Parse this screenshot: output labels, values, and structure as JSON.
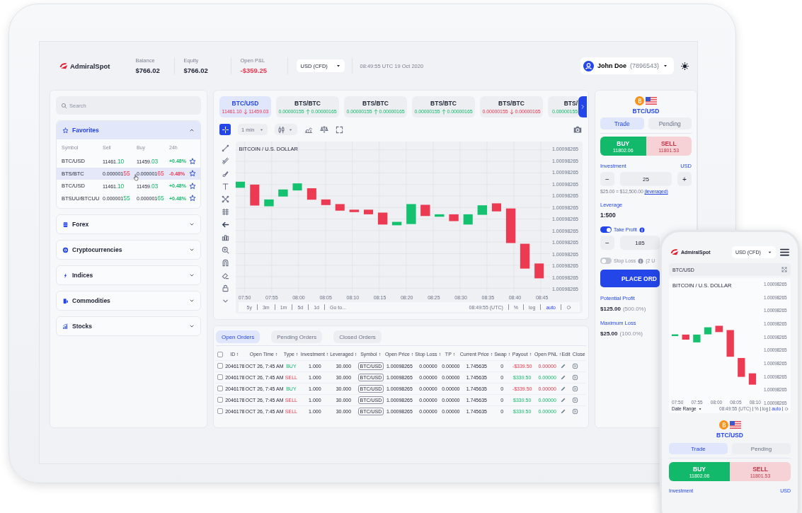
{
  "header": {
    "logo": "AdmiralSpot",
    "stats": [
      {
        "label": "Balance",
        "value": "$766.02",
        "negative": false
      },
      {
        "label": "Equity",
        "value": "$766.02",
        "negative": false
      },
      {
        "label": "Open P&L",
        "value": "-$359.25",
        "negative": true
      }
    ],
    "currency": "USD (CFD)",
    "time": "08:49:55 UTC 19 Oct 2020",
    "user": {
      "name": "John Doe",
      "account": "(7896543)"
    }
  },
  "sidebar": {
    "search": {
      "placeholder": "Search"
    },
    "favorites": {
      "title": "Favorites",
      "expanded": true,
      "columns": [
        "Symbol",
        "Sell",
        "Buy",
        "24h"
      ],
      "rows": [
        {
          "symbol": "BTC/USD",
          "sell": "11461.**10**",
          "sell_positive": true,
          "buy": "11459.**03**",
          "buy_positive": true,
          "change": "+0.48%",
          "change_positive": true,
          "selected": false
        },
        {
          "symbol": "BTS/BTC",
          "sell": "0.000001**55**",
          "sell_positive": false,
          "buy": "0.000001**65**",
          "buy_positive": false,
          "change": "-0.48%",
          "change_positive": false,
          "selected": true
        },
        {
          "symbol": "BTC/USD",
          "sell": "11461.**10**",
          "sell_positive": true,
          "buy": "11459.**03**",
          "buy_positive": true,
          "change": "+0.48%",
          "change_positive": true,
          "selected": false
        },
        {
          "symbol": "BTSUU/BTCUU",
          "sell": "0.000001**55**",
          "sell_positive": true,
          "buy": "0.000001**65**",
          "buy_positive": true,
          "change": "+0.48%",
          "change_positive": true,
          "selected": false
        }
      ]
    },
    "categories": [
      {
        "label": "Forex",
        "expanded": false
      },
      {
        "label": "Cryptocurrencies",
        "expanded": false
      },
      {
        "label": "Indices",
        "expanded": false
      },
      {
        "label": "Commodities",
        "expanded": false
      },
      {
        "label": "Stocks",
        "expanded": false
      }
    ]
  },
  "chart": {
    "tickers": [
      {
        "symbol": "BTC/USD",
        "sell": "11461.10",
        "buy": "11459.03",
        "rising": false,
        "selected": true
      },
      {
        "symbol": "BTS/BTC",
        "sell": "0.00000155",
        "buy": "0.00000165",
        "rising": true,
        "selected": false
      },
      {
        "symbol": "BTS/BTC",
        "sell": "0.00000155",
        "buy": "0.00000165",
        "rising": true,
        "selected": false
      },
      {
        "symbol": "BTS/BTC",
        "sell": "0.00000155",
        "buy": "0.00000165",
        "rising": true,
        "selected": false
      },
      {
        "symbol": "BTS/BTC",
        "sell": "0.00000155",
        "buy": "0.00000165",
        "rising": false,
        "selected": false
      },
      {
        "symbol": "BTS/",
        "sell": "0.00000155",
        "rising": true,
        "selected": false
      }
    ],
    "interval": "1 min",
    "title": "BITCOIN / U.S. DOLLAR",
    "y_labels": [
      "1.00098265",
      "1.00098265",
      "1.00098265",
      "1.00098265",
      "1.00098265",
      "1.00098265",
      "1.00098265",
      "1.00098265",
      "1.00098265",
      "1.00098265",
      "1.00098265",
      "1.00098265",
      "1.00098265"
    ],
    "x_labels": [
      "07:50",
      "07:55",
      "08:00",
      "08:05",
      "08:10",
      "08:15",
      "08:20",
      "08:25",
      "08:30",
      "08:35",
      "08:40",
      "08:45"
    ],
    "ranges": [
      "5y",
      "3m",
      "1m",
      "5d",
      "1d",
      "Go to..."
    ],
    "clock": "08:49:55 (UTC)",
    "scale_options": [
      {
        "label": "%",
        "selected": false
      },
      {
        "label": "log",
        "selected": false
      },
      {
        "label": "auto",
        "selected": true
      }
    ]
  },
  "orders": {
    "tabs": [
      {
        "label": "Open Orders",
        "selected": true
      },
      {
        "label": "Pending Orders",
        "selected": false
      },
      {
        "label": "Closed Orders",
        "selected": false
      }
    ],
    "select_all": {
      "checked": false
    },
    "columns": [
      {
        "label": "ID",
        "sortable": true
      },
      {
        "label": "Open Time",
        "sortable": true
      },
      {
        "label": "Type",
        "sortable": true
      },
      {
        "label": "Investment",
        "sortable": true
      },
      {
        "label": "Leveraged",
        "sortable": true
      },
      {
        "label": "Symbol",
        "sortable": true
      },
      {
        "label": "Open Price",
        "sortable": true
      },
      {
        "label": "Stop Loss",
        "sortable": true
      },
      {
        "label": "TP",
        "sortable": true
      },
      {
        "label": "Current Price",
        "sortable": true
      },
      {
        "label": "Swap",
        "sortable": true
      },
      {
        "label": "Payout",
        "sortable": true
      },
      {
        "label": "Open PNL",
        "sortable": true
      },
      {
        "label": "Edit",
        "sortable": false
      },
      {
        "label": "Close",
        "sortable": false
      }
    ],
    "rows": [
      {
        "checked": false,
        "id": "2046178",
        "open_time": "OCT 26, 7:45 AM",
        "type": "BUY",
        "type_positive": true,
        "investment": "1.000",
        "leveraged": "30.000",
        "symbol": "BTC/USD",
        "open_price": "1.00098265",
        "stop_loss": "0.00000",
        "tp": "0.00000",
        "current_price": "1.745635",
        "swap": "0",
        "payout": "-$339.50",
        "payout_positive": false,
        "open_pnl": "0.00000",
        "pnl_positive": false
      },
      {
        "checked": false,
        "id": "2046178",
        "open_time": "OCT 26, 7:45 AM",
        "type": "SELL",
        "type_positive": false,
        "investment": "1.000",
        "leveraged": "30.000",
        "symbol": "BTC/USD",
        "open_price": "1.00098265",
        "stop_loss": "0.00000",
        "tp": "0.00000",
        "current_price": "1.745635",
        "swap": "0",
        "payout": "$339.50",
        "payout_positive": true,
        "open_pnl": "0.00000",
        "pnl_positive": true
      },
      {
        "checked": false,
        "id": "2046178",
        "open_time": "OCT 26, 7:45 AM",
        "type": "BUY",
        "type_positive": true,
        "investment": "1.000",
        "leveraged": "30.000",
        "symbol": "BTC/USD",
        "open_price": "1.00098265",
        "stop_loss": "0.00000",
        "tp": "0.00000",
        "current_price": "1.745635",
        "swap": "0",
        "payout": "-$339.50",
        "payout_positive": false,
        "open_pnl": "0.00000",
        "pnl_positive": false
      },
      {
        "checked": false,
        "id": "2046178",
        "open_time": "OCT 26, 7:45 AM",
        "type": "SELL",
        "type_positive": false,
        "investment": "1.000",
        "leveraged": "30.000",
        "symbol": "BTC/USD",
        "open_price": "1.00098265",
        "stop_loss": "0.00000",
        "tp": "0.00000",
        "current_price": "1.745635",
        "swap": "0",
        "payout": "$339.50",
        "payout_positive": true,
        "open_pnl": "0.00000",
        "pnl_positive": true
      },
      {
        "checked": false,
        "id": "2046178",
        "open_time": "OCT 26, 7:45 AM",
        "type": "SELL",
        "type_positive": false,
        "investment": "1.000",
        "leveraged": "30.000",
        "symbol": "BTC/USD",
        "open_price": "1.00098265",
        "stop_loss": "0.00000",
        "tp": "0.00000",
        "current_price": "1.745635",
        "swap": "0",
        "payout": "$339.50",
        "payout_positive": true,
        "open_pnl": "0.00000",
        "pnl_positive": true
      }
    ]
  },
  "trade": {
    "symbol": "BTC/USD",
    "tabs": [
      {
        "label": "Trade",
        "selected": true
      },
      {
        "label": "Pending",
        "selected": false
      }
    ],
    "sides": [
      {
        "label": "BUY",
        "price": "11802.06",
        "positive": true,
        "selected": true
      },
      {
        "label": "SELL",
        "price": "11801.53",
        "positive": false,
        "selected": false
      }
    ],
    "investment": {
      "label": "Investment",
      "currency": "USD",
      "decrement": "−",
      "value": "25",
      "increment": "+",
      "note": "$25.00 = $12,500.00",
      "link": "(leveraged)"
    },
    "leverage": {
      "label": "Leverage",
      "value": "1:500"
    },
    "take_profit": {
      "label": "Take Profit",
      "on": true,
      "decrement": "−",
      "value": "185"
    },
    "stop_loss": {
      "label": "Stop Loss",
      "on": false,
      "note": "(2 U"
    },
    "place_order": "PLACE ORD",
    "results": [
      {
        "label": "Potential Profit",
        "value": "$125.00",
        "percent": "(500.0%)"
      },
      {
        "label": "Maximum Loss",
        "value": "$25.00",
        "percent": "(100.0%)"
      }
    ]
  },
  "phone": {
    "logo": "AdmiralSpot",
    "currency": "USD (CFD)",
    "symbol": "BTC/USD",
    "chart": {
      "title": "BITCOIN / U.S. DOLLAR",
      "y_labels": [
        "1.00098265",
        "1.00098265",
        "1.00098265",
        "1.00098265",
        "1.00098265",
        "1.00098265",
        "1.00098265",
        "1.00098265",
        "1.00098265",
        "1.00098265"
      ],
      "x_labels": [
        "07:50",
        "07:55",
        "08:00",
        "08:05",
        "08:10"
      ],
      "date_range": "Date Range",
      "clock": "08:49:55 (UTC)",
      "scale_options": [
        {
          "label": "%",
          "selected": false
        },
        {
          "label": "log",
          "selected": false
        },
        {
          "label": "auto",
          "selected": true
        }
      ]
    },
    "pair": "BTC/USD",
    "tabs": [
      {
        "label": "Trade",
        "selected": true
      },
      {
        "label": "Pending",
        "selected": false
      }
    ],
    "sides": [
      {
        "label": "BUY",
        "price": "11802.06",
        "positive": true,
        "selected": true
      },
      {
        "label": "SELL",
        "price": "11801.53",
        "positive": false,
        "selected": false
      }
    ],
    "investment": {
      "label": "Investment",
      "currency": "USD"
    }
  }
}
